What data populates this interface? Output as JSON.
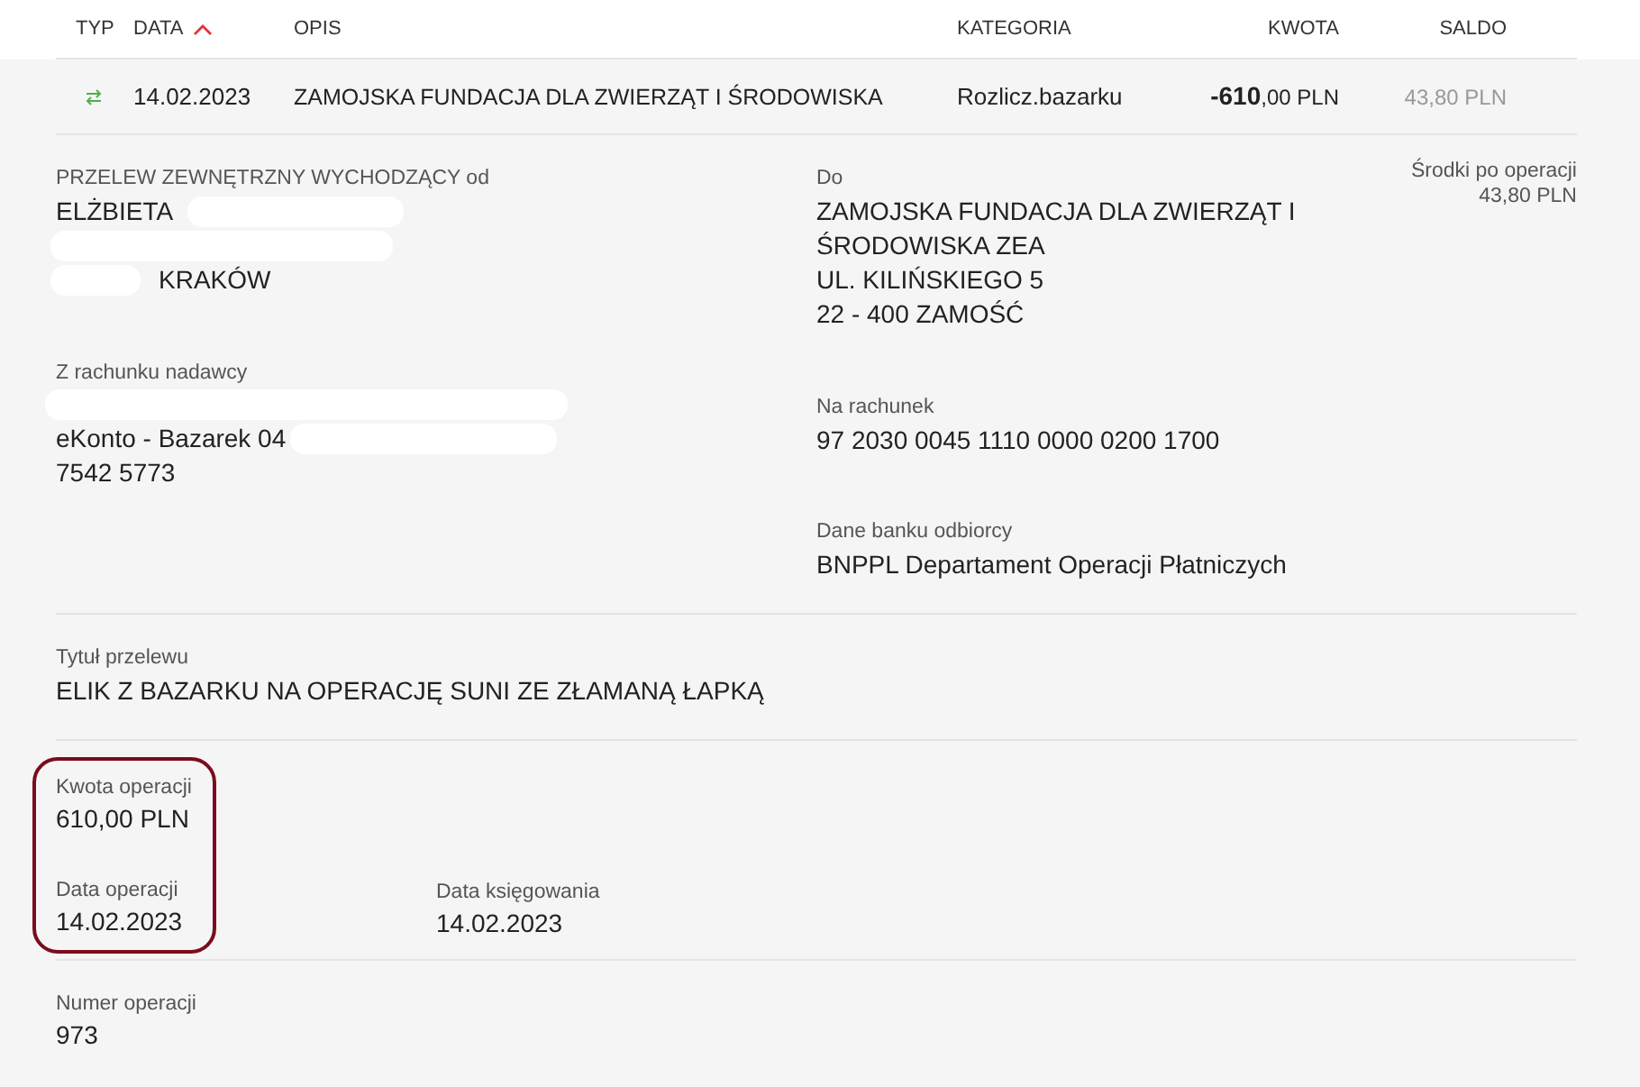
{
  "table": {
    "columns": [
      {
        "label": "TYP",
        "sorted": false
      },
      {
        "label": "DATA",
        "sorted": true
      },
      {
        "label": "OPIS",
        "sorted": false
      },
      {
        "label": "KATEGORIA",
        "sorted": false
      },
      {
        "label": "KWOTA",
        "sorted": false
      },
      {
        "label": "SALDO",
        "sorted": false
      }
    ],
    "row": {
      "date": "14.02.2023",
      "description": "ZAMOJSKA FUNDACJA DLA ZWIERZĄT I ŚRODOWISKA",
      "category": "Rozlicz.bazarku",
      "amount_whole": "-610",
      "amount_rest": ",00 PLN",
      "balance": "43,80 PLN"
    }
  },
  "details": {
    "sender": {
      "label": "PRZELEW ZEWNĘTRZNY WYCHODZĄCY od",
      "lines": [
        "ELŻBIETA",
        "KRAKÓW"
      ]
    },
    "sender_account": {
      "label": "Z rachunku nadawcy",
      "lines": [
        "eKonto - Bazarek 04",
        "7542 5773"
      ]
    },
    "recipient": {
      "label": "Do",
      "lines": [
        "ZAMOJSKA FUNDACJA DLA ZWIERZĄT I",
        "ŚRODOWISKA ZEA",
        "UL. KILIŃSKIEGO 5",
        "22 - 400 ZAMOŚĆ"
      ]
    },
    "recipient_account": {
      "label": "Na rachunek",
      "value": "97 2030 0045 1110 0000 0200 1700"
    },
    "recipient_bank": {
      "label": "Dane banku odbiorcy",
      "value": "BNPPL Departament Operacji Płatniczych"
    },
    "balance_after": {
      "label": "Środki po operacji",
      "value": "43,80 PLN"
    },
    "title": {
      "label": "Tytuł przelewu",
      "value": "ELIK Z BAZARKU NA OPERACJĘ SUNI ZE ZŁAMANĄ ŁAPKĄ"
    },
    "amount_group_outlined": true,
    "amount": {
      "label": "Kwota operacji",
      "value": "610,00 PLN"
    },
    "operation_date": {
      "label": "Data operacji",
      "value": "14.02.2023"
    },
    "booking_date": {
      "label": "Data księgowania",
      "value": "14.02.2023"
    },
    "operation_number": {
      "label": "Numer operacji",
      "value": "973"
    }
  }
}
